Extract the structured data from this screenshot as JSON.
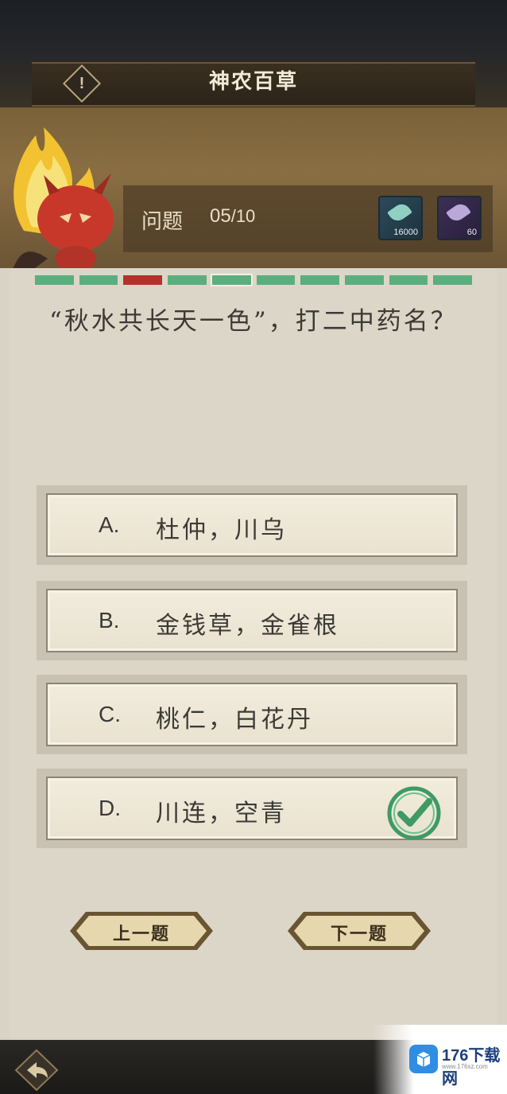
{
  "header": {
    "title": "神农百草",
    "question_label": "问题",
    "question_current": "05",
    "question_total": "/10",
    "items": [
      {
        "icon": "herb-leaf-icon",
        "count": "16000",
        "color": "#2c4a5a"
      },
      {
        "icon": "purple-herb-icon",
        "count": "60",
        "color": "#3c2f55"
      }
    ]
  },
  "progress": {
    "segments": [
      "correct",
      "correct",
      "wrong",
      "correct",
      "current",
      "correct",
      "correct",
      "correct",
      "correct",
      "correct"
    ],
    "colors": {
      "correct": "#5bae7e",
      "wrong": "#b2332c"
    }
  },
  "question": {
    "text": "“秋水共长天一色”，打二中药名？"
  },
  "options": [
    {
      "letter": "A.",
      "text": "杜仲，川乌",
      "correct": false
    },
    {
      "letter": "B.",
      "text": "金钱草，金雀根",
      "correct": false
    },
    {
      "letter": "C.",
      "text": "桃仁，白花丹",
      "correct": false
    },
    {
      "letter": "D.",
      "text": "川连，空青",
      "correct": true
    }
  ],
  "nav": {
    "prev_label": "上一题",
    "next_label": "下一题"
  },
  "watermark": {
    "name": "176下载网",
    "url": "www.176sz.com"
  }
}
